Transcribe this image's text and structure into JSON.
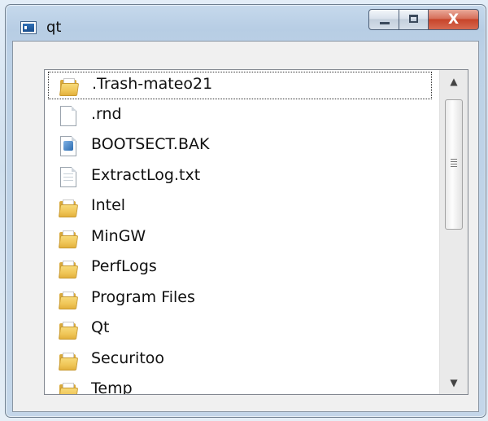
{
  "window": {
    "title": "qt",
    "close_label": "X"
  },
  "list": {
    "items": [
      {
        "label": ".Trash-mateo21",
        "icon": "folder-icon",
        "focused": true
      },
      {
        "label": ".rnd",
        "icon": "file-icon"
      },
      {
        "label": "BOOTSECT.BAK",
        "icon": "system-file-icon"
      },
      {
        "label": "ExtractLog.txt",
        "icon": "text-file-icon"
      },
      {
        "label": "Intel",
        "icon": "folder-icon"
      },
      {
        "label": "MinGW",
        "icon": "folder-icon"
      },
      {
        "label": "PerfLogs",
        "icon": "folder-icon"
      },
      {
        "label": "Program Files",
        "icon": "folder-icon"
      },
      {
        "label": "Qt",
        "icon": "folder-icon"
      },
      {
        "label": "Securitoo",
        "icon": "folder-icon"
      },
      {
        "label": "Temp",
        "icon": "folder-icon"
      }
    ]
  },
  "scrollbar": {
    "up_glyph": "▲",
    "down_glyph": "▼"
  }
}
